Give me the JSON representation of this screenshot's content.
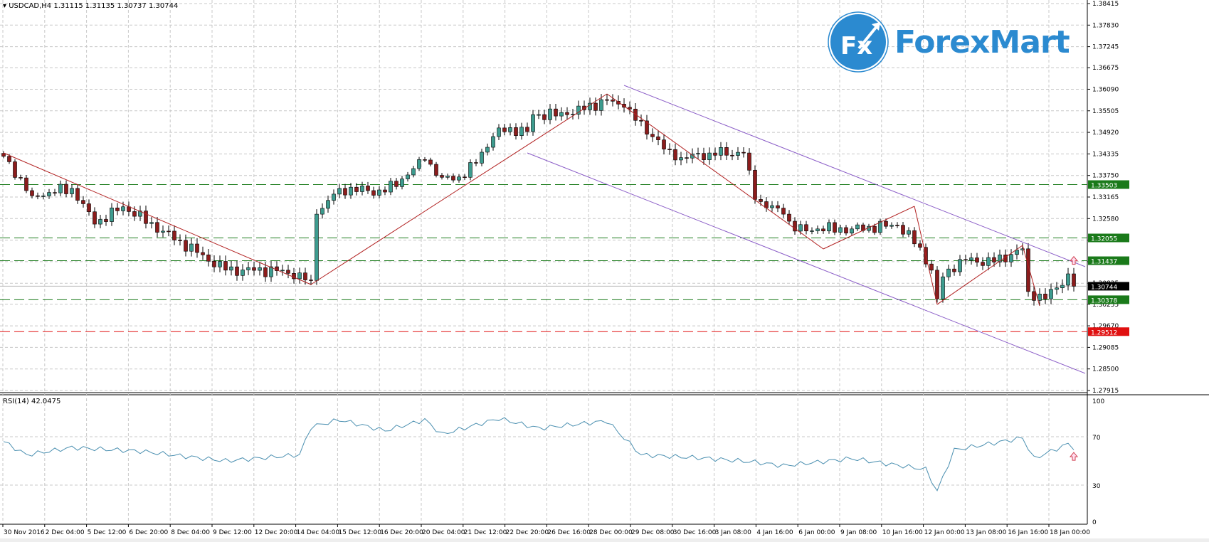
{
  "header": {
    "symbol": "USDCAD,H4",
    "ohlc_text": "1.31115 1.31135 1.30737 1.30744"
  },
  "rsi": {
    "title": "RSI(14) 42.0475",
    "levels": [
      "100",
      "70",
      "30",
      "0"
    ]
  },
  "logo": {
    "text": "ForexMart",
    "mark": "Fx"
  },
  "colors": {
    "bull": "#3d9c8f",
    "bear": "#8c1c1c",
    "trend": "#b22222",
    "channel": "#8a5cc7",
    "support": "#1a7a1a",
    "resistance_red": "#e01010",
    "rsi_line": "#4a8fb0",
    "logo": "#2b8ad0"
  },
  "chart_data": {
    "type": "candlestick",
    "title": "USDCAD,H4",
    "ylim": [
      1.27915,
      1.38415
    ],
    "y_ticks": [
      "1.38415",
      "1.37830",
      "1.37245",
      "1.36675",
      "1.36090",
      "1.35505",
      "1.34920",
      "1.34335",
      "1.33750",
      "1.33165",
      "1.32580",
      "1.31995",
      "1.31410",
      "1.30825",
      "1.30255",
      "1.29670",
      "1.29085",
      "1.28500",
      "1.27915"
    ],
    "x_ticks": [
      "30 Nov 2016",
      "2 Dec 04:00",
      "5 Dec 12:00",
      "6 Dec 20:00",
      "8 Dec 04:00",
      "9 Dec 12:00",
      "12 Dec 20:00",
      "14 Dec 04:00",
      "15 Dec 12:00",
      "16 Dec 20:00",
      "20 Dec 04:00",
      "21 Dec 12:00",
      "22 Dec 20:00",
      "26 Dec 16:00",
      "28 Dec 00:00",
      "29 Dec 08:00",
      "30 Dec 16:00",
      "3 Jan 08:00",
      "4 Jan 16:00",
      "6 Jan 00:00",
      "9 Jan 08:00",
      "10 Jan 16:00",
      "12 Jan 00:00",
      "13 Jan 08:00",
      "16 Jan 16:00",
      "18 Jan 00:00"
    ],
    "bar_count": 189,
    "close_waypoints": [
      [
        0,
        1.3427
      ],
      [
        5,
        1.332
      ],
      [
        12,
        1.334
      ],
      [
        16,
        1.3243
      ],
      [
        21,
        1.329
      ],
      [
        28,
        1.3224
      ],
      [
        39,
        1.3118
      ],
      [
        49,
        1.3118
      ],
      [
        54,
        1.309
      ],
      [
        55,
        1.327
      ],
      [
        59,
        1.334
      ],
      [
        67,
        1.333
      ],
      [
        74,
        1.3417
      ],
      [
        77,
        1.337
      ],
      [
        81,
        1.337
      ],
      [
        87,
        1.3504
      ],
      [
        92,
        1.3494
      ],
      [
        93,
        1.354
      ],
      [
        99,
        1.354
      ],
      [
        106,
        1.358
      ],
      [
        109,
        1.356
      ],
      [
        114,
        1.348
      ],
      [
        118,
        1.3417
      ],
      [
        124,
        1.3436
      ],
      [
        130,
        1.3436
      ],
      [
        132,
        1.331
      ],
      [
        137,
        1.327
      ],
      [
        139,
        1.3224
      ],
      [
        143,
        1.323
      ],
      [
        149,
        1.323
      ],
      [
        157,
        1.324
      ],
      [
        161,
        1.318
      ],
      [
        163,
        1.3118
      ],
      [
        164,
        1.304
      ],
      [
        165,
        1.31
      ],
      [
        168,
        1.3147
      ],
      [
        174,
        1.314
      ],
      [
        179,
        1.3176
      ],
      [
        180,
        1.306
      ],
      [
        183,
        1.304
      ],
      [
        185,
        1.307
      ],
      [
        187,
        1.3108
      ],
      [
        188,
        1.30744
      ]
    ],
    "current_price": "1.30744",
    "horizontal_levels": [
      {
        "price": 1.33503,
        "label": "1.33503",
        "color": "green"
      },
      {
        "price": 1.32055,
        "label": "1.32055",
        "color": "green"
      },
      {
        "price": 1.31437,
        "label": "1.31437",
        "color": "green"
      },
      {
        "price": 1.30378,
        "label": "1.30378",
        "color": "green"
      },
      {
        "price": 1.29512,
        "label": "1.29512",
        "color": "red"
      }
    ],
    "trend_lines": [
      [
        [
          0,
          1.34362
        ],
        [
          54,
          1.30791
        ]
      ],
      [
        [
          54,
          1.30791
        ],
        [
          106,
          1.35964
        ]
      ],
      [
        [
          106,
          1.35964
        ],
        [
          144,
          1.31756
        ]
      ],
      [
        [
          144,
          1.31756
        ],
        [
          160,
          1.32914
        ]
      ],
      [
        [
          160,
          1.32914
        ],
        [
          164,
          1.30251
        ]
      ],
      [
        [
          164,
          1.30251
        ],
        [
          179,
          1.31853
        ]
      ],
      [
        [
          179,
          1.31853
        ],
        [
          182,
          1.30212
        ]
      ]
    ],
    "channel_lines": [
      [
        [
          109,
          1.36195
        ],
        [
          190,
          1.31274
        ]
      ],
      [
        [
          92,
          1.34362
        ],
        [
          190,
          1.28379
        ]
      ]
    ],
    "rsi_waypoints": [
      [
        0,
        66
      ],
      [
        4,
        55
      ],
      [
        12,
        61
      ],
      [
        24,
        58
      ],
      [
        39,
        50
      ],
      [
        52,
        55
      ],
      [
        54,
        78
      ],
      [
        59,
        84
      ],
      [
        67,
        75
      ],
      [
        74,
        84
      ],
      [
        77,
        72
      ],
      [
        87,
        85
      ],
      [
        94,
        77
      ],
      [
        106,
        83
      ],
      [
        112,
        55
      ],
      [
        124,
        52
      ],
      [
        132,
        49
      ],
      [
        137,
        46
      ],
      [
        149,
        52
      ],
      [
        162,
        43
      ],
      [
        164,
        25
      ],
      [
        167,
        59
      ],
      [
        179,
        69
      ],
      [
        181,
        52
      ],
      [
        187,
        64
      ],
      [
        188,
        61
      ]
    ],
    "rsi_ylim": [
      0,
      100
    ]
  }
}
